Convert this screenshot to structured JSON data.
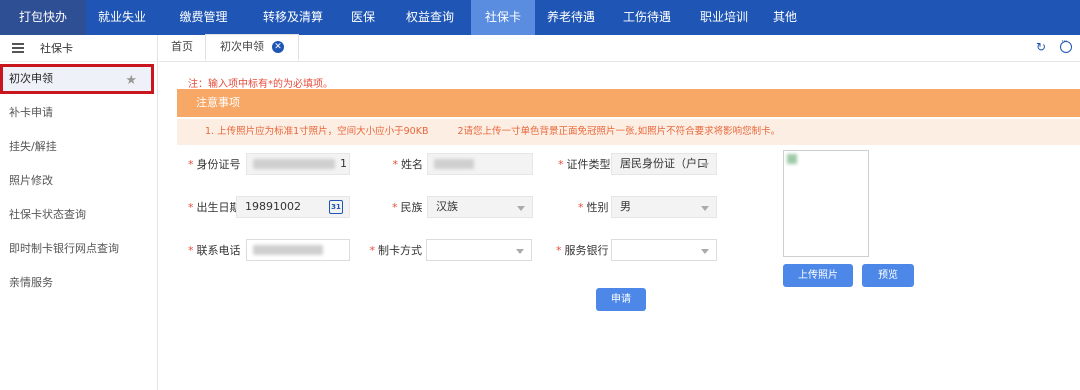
{
  "topnav": {
    "items": [
      "打包快办",
      "就业失业",
      "缴费管理",
      "转移及清算",
      "医保",
      "权益查询",
      "社保卡",
      "养老待遇",
      "工伤待遇",
      "职业培训",
      "其他"
    ]
  },
  "sidebar": {
    "header": "社保卡",
    "items": [
      "初次申领",
      "补卡申请",
      "挂失/解挂",
      "照片修改",
      "社保卡状态查询",
      "即时制卡银行网点查询",
      "亲情服务"
    ]
  },
  "tabs": {
    "home": "首页",
    "active": "初次申领"
  },
  "form": {
    "note": "注：输入项中标有*的为必填项。",
    "notice_title": "注意事项",
    "notice_1": "1. 上传照片应为标准1寸照片，空间大小应小于90KB",
    "notice_2": "2请您上传一寸单色背景正面免冠照片一张,如照片不符合要求将影响您制卡。",
    "required_mark": "*",
    "id_label": "身份证号",
    "id_value_tail": "1",
    "name_label": "姓名",
    "idtype_label": "证件类型",
    "idtype_value": "居民身份证（户口",
    "birth_label": "出生日期",
    "birth_value": "19891002",
    "ethnic_label": "民族",
    "ethnic_value": "汉族",
    "gender_label": "性别",
    "gender_value": "男",
    "phone_label": "联系电话",
    "cardway_label": "制卡方式",
    "bank_label": "服务银行",
    "upload_button": "上传照片",
    "preview_button": "预览",
    "submit_button": "申请",
    "calendar_day": "31"
  },
  "colors": {
    "nav_bg": "#1f56b5",
    "nav_active": "#5a8de0",
    "notice_orange": "#f7a766",
    "button_blue": "#4d88e8",
    "highlight_red": "#c9151e"
  },
  "icons": [
    "menu-icon",
    "star-icon",
    "close-icon",
    "refresh-icon",
    "more-icon",
    "calendar-icon",
    "chevron-down-icon"
  ]
}
